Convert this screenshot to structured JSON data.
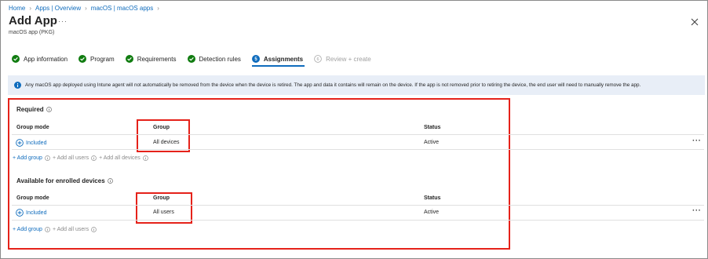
{
  "breadcrumb": [
    "Home",
    "Apps | Overview",
    "macOS | macOS apps"
  ],
  "header": {
    "title": "Add App",
    "more": "···",
    "subtitle": "macOS app (PKG)"
  },
  "steps": [
    {
      "label": "App information",
      "state": "complete"
    },
    {
      "label": "Program",
      "state": "complete"
    },
    {
      "label": "Requirements",
      "state": "complete"
    },
    {
      "label": "Detection rules",
      "state": "complete"
    },
    {
      "label": "Assignments",
      "number": "5",
      "state": "active"
    },
    {
      "label": "Review + create",
      "number": "6",
      "state": "disabled"
    }
  ],
  "info_banner": "Any macOS app deployed using Intune agent will not automatically be removed from the device when the device is retired. The app and data it contains will remain on the device. If the app is not removed prior to retiring the device, the end user will need to manually remove the app.",
  "required": {
    "title": "Required",
    "columns": {
      "group_mode": "Group mode",
      "group": "Group",
      "status": "Status"
    },
    "row": {
      "mode": "Included",
      "group": "All devices",
      "status": "Active",
      "more": "···"
    },
    "add_group": "+ Add group",
    "add_all_users": "+ Add all users",
    "add_all_devices": "+ Add all devices"
  },
  "available": {
    "title": "Available for enrolled devices",
    "columns": {
      "group_mode": "Group mode",
      "group": "Group",
      "status": "Status"
    },
    "row": {
      "mode": "Included",
      "group": "All users",
      "status": "Active",
      "more": "···"
    },
    "add_group": "+ Add group",
    "add_all_users": "+ Add all users"
  },
  "colors": {
    "accent": "#0f6cbd",
    "success": "#107c10",
    "highlight": "#e5221a",
    "banner": "#e8eef7"
  },
  "icons": [
    "chevron-right-icon",
    "close-icon",
    "check-circle-icon",
    "info-icon",
    "add-circle-icon",
    "more-icon"
  ]
}
